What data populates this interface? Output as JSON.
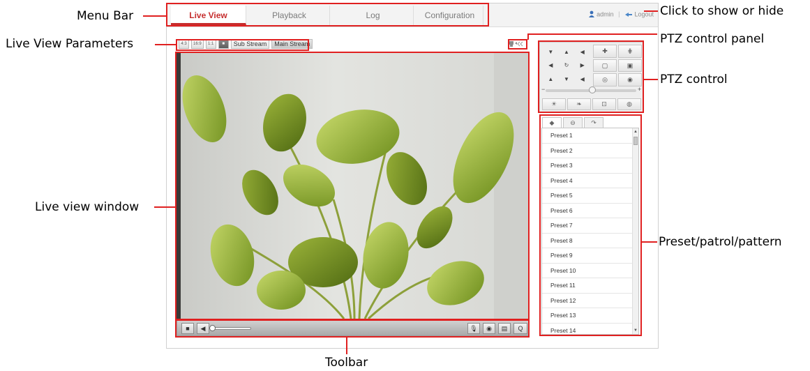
{
  "annotations": {
    "menu_bar": "Menu Bar",
    "live_view_params": "Live View Parameters",
    "live_view_window": "Live view window",
    "toolbar": "Toolbar",
    "click_toggle": "Click to show or hide",
    "ptz_panel": "PTZ control panel",
    "ptz_control": "PTZ control",
    "preset": "Preset/patrol/pattern"
  },
  "menu": {
    "tabs": [
      "Live View",
      "Playback",
      "Log",
      "Configuration"
    ],
    "active": "Live View",
    "user": "admin",
    "separator": "|",
    "logout": "Logout"
  },
  "params": {
    "ratio_4_3": "4:3",
    "ratio_16_9": "16:9",
    "ratio_1_1": "1:1",
    "sub_stream": "Sub Stream",
    "main_stream": "Main Stream"
  },
  "preset_list": {
    "items": [
      "Preset 1",
      "Preset 2",
      "Preset 3",
      "Preset 4",
      "Preset 5",
      "Preset 6",
      "Preset 7",
      "Preset 8",
      "Preset 9",
      "Preset 10",
      "Preset 11",
      "Preset 12",
      "Preset 13",
      "Preset 14"
    ]
  },
  "ptz": {
    "minus": "−",
    "plus": "+"
  },
  "colors": {
    "annotation_red": "#e02020",
    "active_tab": "#c62e2e"
  }
}
